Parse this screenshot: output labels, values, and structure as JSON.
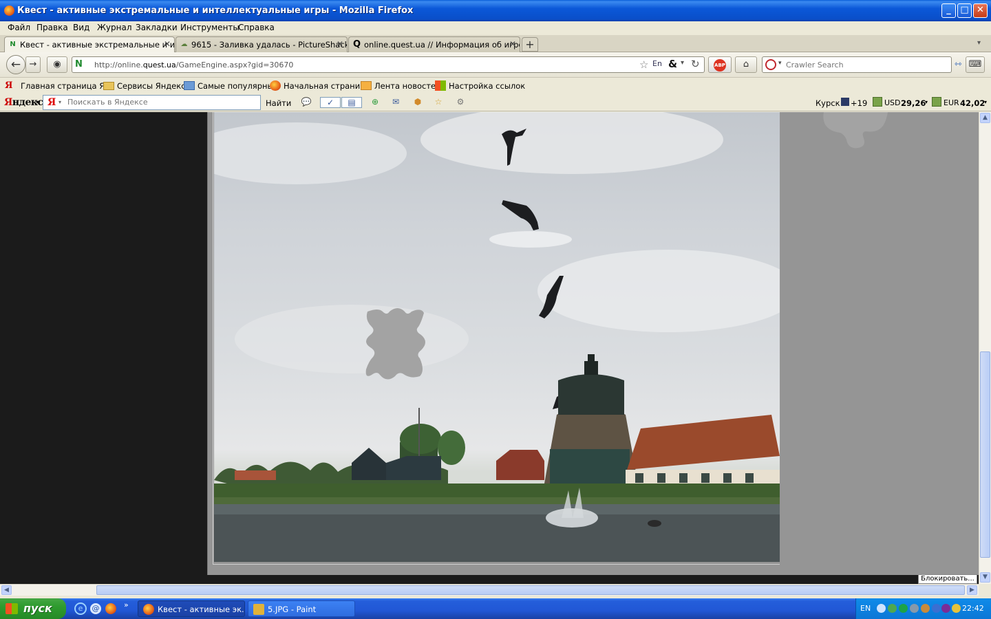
{
  "window": {
    "title": "Квест - активные экстремальные и интеллектуальные игры - Mozilla Firefox",
    "minimize": "_",
    "maximize": "□",
    "close": "✕"
  },
  "menu": [
    "Файл",
    "Правка",
    "Вид",
    "Журнал",
    "Закладки",
    "Инструменты",
    "Справка"
  ],
  "tabs": [
    {
      "label": "Квест - активные экстремальные и ин...",
      "icon": "N",
      "active": true
    },
    {
      "label": "9615 - Заливка удалась - PictureShack...",
      "icon": "☁",
      "active": false
    },
    {
      "label": "online.quest.ua // Информация об игре ...",
      "icon": "Q",
      "active": false
    }
  ],
  "tab_close": "✕",
  "tab_new": "+",
  "nav": {
    "url_prefix": "http://online.",
    "url_domain": "quest.ua",
    "url_path": "/GameEngine.aspx?gid=30670",
    "site_icon": "N",
    "search_placeholder": "Crawler Search"
  },
  "bookmarks": [
    "Главная страница Я...",
    "Сервисы Яндекса",
    "Самые популярные",
    "Начальная страница",
    "Лента новостей",
    "Настройка ссылок"
  ],
  "yandex": {
    "logo_first": "Я",
    "logo_rest": "ндекс",
    "input_mark": "Я",
    "search_placeholder": "Поискать в Яндексе",
    "find_label": "Найти",
    "kursk_label": "Курск",
    "weather": "+19",
    "usd": "USD",
    "usd_value": "29,26",
    "eur": "EUR",
    "eur_value": "42,02"
  },
  "block_button": "Блокировать...",
  "taskbar": {
    "start": "пуск",
    "tasks": [
      {
        "label": "Квест - активные эк...",
        "active": true
      },
      {
        "label": "5.JPG - Paint",
        "active": false
      }
    ],
    "lang": "EN",
    "clock": "22:42"
  },
  "colors": {
    "content_bg": "#1b1b1b",
    "panel_bg": "#959595",
    "piece_color": "#a3a3a3"
  }
}
